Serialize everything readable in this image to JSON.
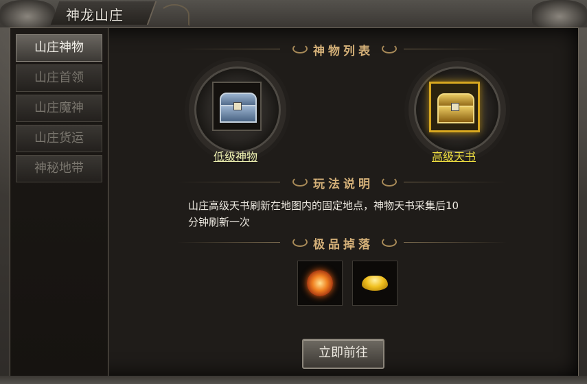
{
  "window": {
    "title": "神龙山庄"
  },
  "sidebar": {
    "tabs": [
      {
        "label": "山庄神物",
        "active": true
      },
      {
        "label": "山庄首领",
        "active": false
      },
      {
        "label": "山庄魔神",
        "active": false
      },
      {
        "label": "山庄货运",
        "active": false
      },
      {
        "label": "神秘地带",
        "active": false
      }
    ]
  },
  "main": {
    "item_list_title": "神物列表",
    "items": [
      {
        "label": "低级神物",
        "icon": "silver-chest-icon",
        "label_color": "#ecefb0"
      },
      {
        "label": "高级天书",
        "icon": "gold-chest-icon",
        "label_color": "#f0e040"
      }
    ],
    "rules_title": "玩法说明",
    "rules_text_line1": "山庄高级天书刷新在地图内的固定地点，神物天书采集后10",
    "rules_text_line2": "分钟刷新一次",
    "drops_title": "极品掉落",
    "drops": [
      {
        "icon": "fire-orb-icon"
      },
      {
        "icon": "gold-ingot-icon"
      }
    ],
    "go_button": "立即前往"
  },
  "colors": {
    "accent_gold": "#d4b078",
    "active_tab_text": "#f2efe8",
    "inactive_tab_text": "#7a766e"
  }
}
